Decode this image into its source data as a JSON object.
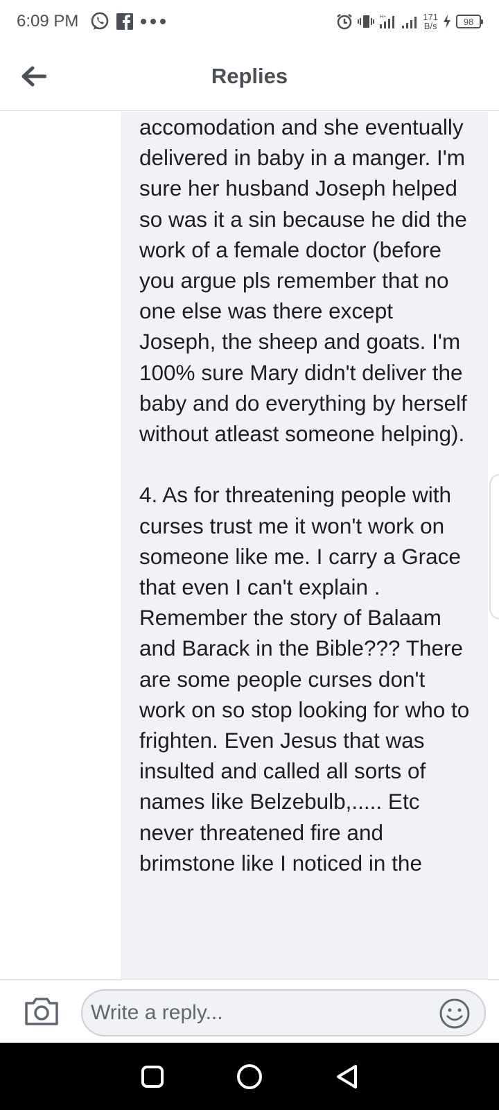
{
  "status_bar": {
    "time": "6:09 PM",
    "net_speed_value": "171",
    "net_speed_unit": "B/s",
    "battery": "98",
    "icons": [
      "whatsapp-icon",
      "facebook-icon",
      "more-dots-icon",
      "alarm-icon",
      "vibrate-icon",
      "signal-icon",
      "signal-icon",
      "charging-icon"
    ]
  },
  "header": {
    "title": "Replies",
    "back_icon": "arrow-left-icon"
  },
  "reply": {
    "paragraphs": [
      "accomodation and she eventually delivered in baby in a manger. I'm sure her husband Joseph helped so was it a sin because he did the work of a female doctor (before you argue pls remember that no one else was there except Joseph, the sheep and goats. I'm 100% sure Mary didn't deliver the baby and do everything by herself without atleast someone helping).",
      "4. As for threatening people with curses trust me it won't work on someone like me. I carry a Grace that even I can't explain . Remember the story of Balaam and Barack in the Bible??? There are some people curses don't work on so stop looking for who to frighten. Even Jesus that was insulted and called all sorts of names like Belzebulb,..... Etc never threatened fire and brimstone like I noticed in the"
    ]
  },
  "composer": {
    "placeholder": "Write a reply...",
    "camera_icon": "camera-icon",
    "emoji_icon": "emoji-icon"
  },
  "nav_bar": {
    "icons": [
      "recents-square-icon",
      "home-circle-icon",
      "back-triangle-icon"
    ]
  },
  "colors": {
    "bubble_bg": "#f0f2f5",
    "text": "#1c1e21",
    "icon_gray": "#4b4f56",
    "nav_bg": "#000000"
  }
}
